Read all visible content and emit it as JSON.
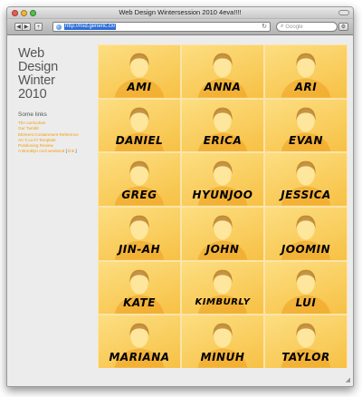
{
  "window": {
    "title": "Web Design Wintersession 2010 4eva!!!!"
  },
  "toolbar": {
    "back_glyph": "◀",
    "forward_glyph": "▶",
    "add_glyph": "+",
    "url": "http://risd.generic.cx/",
    "reload_glyph": "↻",
    "search_placeholder": "Google",
    "search_glyph": "⌕",
    "gear_glyph": "⚙"
  },
  "sidebar": {
    "title_lines": [
      "Web",
      "Design",
      "Winter",
      "2010"
    ],
    "links_heading": "Some links",
    "links": [
      {
        "text": "The curriculum"
      },
      {
        "text": "Our Tumblr"
      },
      {
        "text": "Element Containment Reference"
      },
      {
        "text": "Ari 's Lo-Fi Template"
      },
      {
        "text": "Positioning Review"
      },
      {
        "text": "A Brooklyn cool weekend",
        "suffix_open": " [ ",
        "suffix_link": "link",
        "suffix_close": " ]"
      }
    ]
  },
  "students": [
    {
      "name": "AMI"
    },
    {
      "name": "ANNA"
    },
    {
      "name": "ARI"
    },
    {
      "name": "DANIEL"
    },
    {
      "name": "ERICA"
    },
    {
      "name": "EVAN"
    },
    {
      "name": "GREG"
    },
    {
      "name": "HYUNJOO"
    },
    {
      "name": "JESSICA"
    },
    {
      "name": "JIN-AH"
    },
    {
      "name": "JOHN"
    },
    {
      "name": "JOOMIN"
    },
    {
      "name": "KATE"
    },
    {
      "name": "KIMBURLY"
    },
    {
      "name": "LUI"
    },
    {
      "name": "MARIANA"
    },
    {
      "name": "MINUH"
    },
    {
      "name": "TAYLOR"
    }
  ],
  "colors": {
    "accent_link": "#f29c00",
    "tile_yellow": "#fcd45a",
    "name_text": "#000000"
  }
}
